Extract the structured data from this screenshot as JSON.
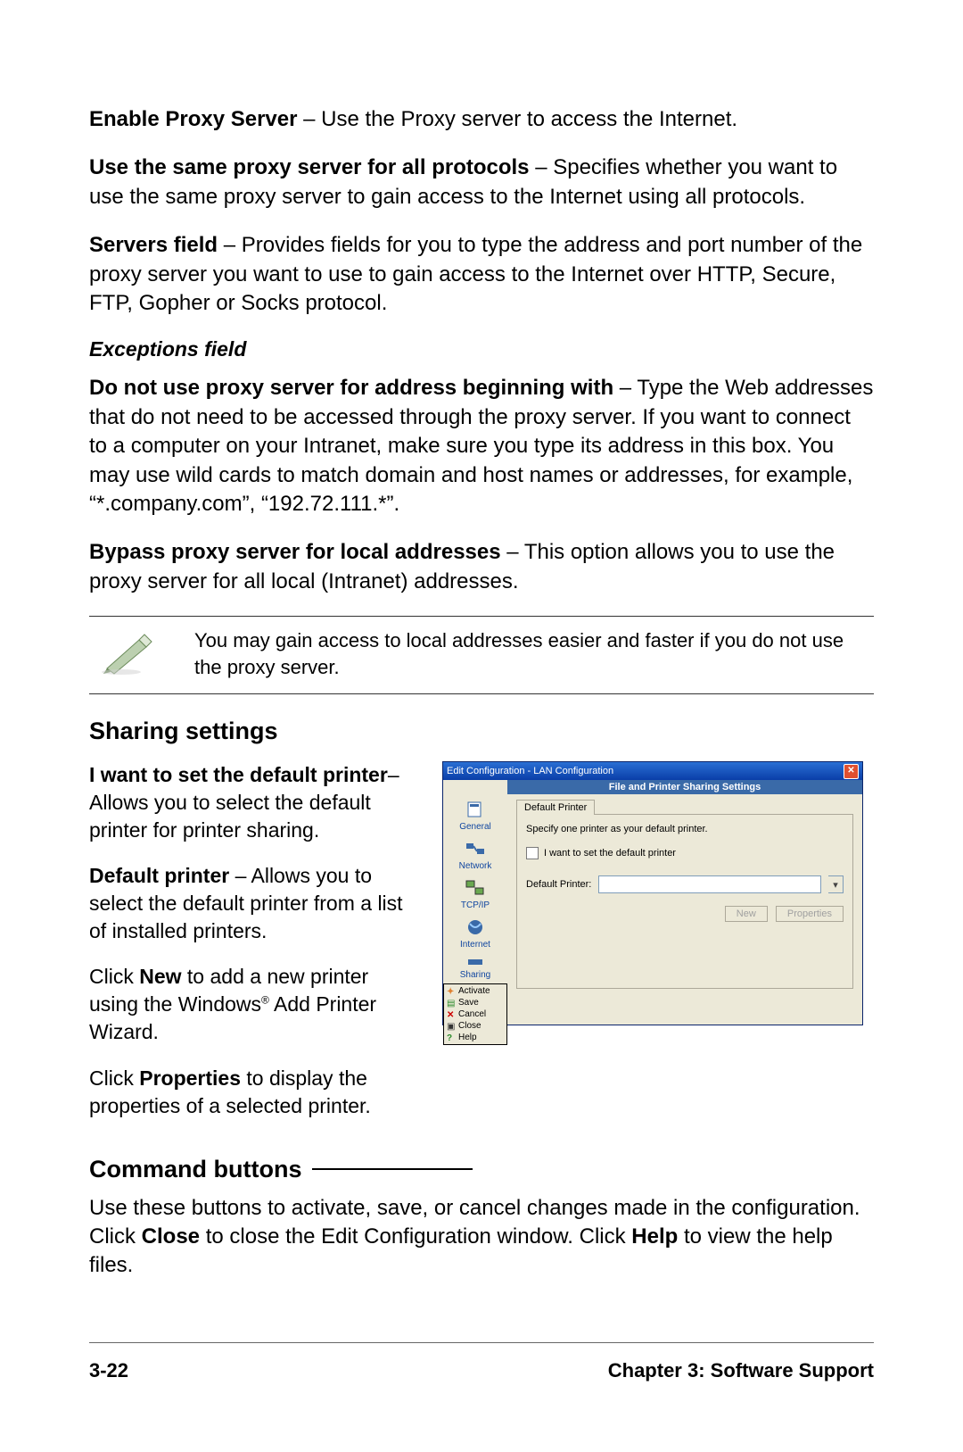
{
  "para_enable_b": "Enable Proxy Server",
  "para_enable_t": " – Use the Proxy server to access the Internet.",
  "para_same_b": "Use the same proxy server for all protocols",
  "para_same_t": " – Specifies whether you want to use the same proxy server to gain access to the Internet using all protocols.",
  "para_servers_b": "Servers field",
  "para_servers_t": " – Provides fields for you to type the address and port number of the proxy server you want to use to gain access to the Internet over HTTP, Secure, FTP, Gopher or Socks protocol.",
  "exceptions_h": "Exceptions field",
  "para_donot_b": "Do not use proxy server for address beginning with",
  "para_donot_t": " – Type the Web addresses that do not need to be accessed through the proxy server. If you want to connect to a computer on your Intranet, make sure you type its address in this box. You may use wild cards to match domain and host names or addresses, for example, “*.company.com”, “192.72.111.*”.",
  "para_bypass_b": "Bypass proxy server for local addresses",
  "para_bypass_t": " – This option allows you to use the proxy server for all local (Intranet) addresses.",
  "note_text": "You may gain access to local addresses easier and faster if you do not use the proxy server.",
  "sharing_h": "Sharing settings",
  "p_want_b": "I want to set the default printer",
  "p_want_t": "– Allows you to select the default printer for printer sharing.",
  "p_def_b": "Default printer",
  "p_def_t": " – Allows you to select the default printer from a list of installed printers.",
  "p_new_1": "Click ",
  "p_new_b": "New",
  "p_new_2": " to add a new printer using the Windows",
  "p_new_r": "®",
  "p_new_3": " Add Printer Wizard.",
  "p_prop_1": "Click ",
  "p_prop_b": "Properties",
  "p_prop_2": " to display the properties of a selected printer.",
  "cmd_h": "Command buttons",
  "cmd_para_1": "Use these buttons to activate, save, or cancel changes made in the configuration. Click ",
  "cmd_para_b1": "Close",
  "cmd_para_2": " to close the Edit Configuration window. Click ",
  "cmd_para_b2": "Help",
  "cmd_para_3": " to view the help files.",
  "dlg": {
    "title": "Edit Configuration - LAN Configuration",
    "subtitle": "File and Printer Sharing Settings",
    "side": {
      "general": "General",
      "network": "Network",
      "tcpip": "TCP/IP",
      "internet": "Internet",
      "sharing": "Sharing"
    },
    "cmd": {
      "activate": "Activate",
      "save": "Save",
      "cancel": "Cancel",
      "close": "Close",
      "help": "Help"
    },
    "tab": "Default Printer",
    "grp_text": "Specify one printer as your default printer.",
    "chk_label": "I want to set the default printer",
    "field_label": "Default Printer:",
    "btn_new": "New",
    "btn_prop": "Properties"
  },
  "footer": {
    "page": "3-22",
    "chapter": "Chapter 3: Software Support"
  }
}
